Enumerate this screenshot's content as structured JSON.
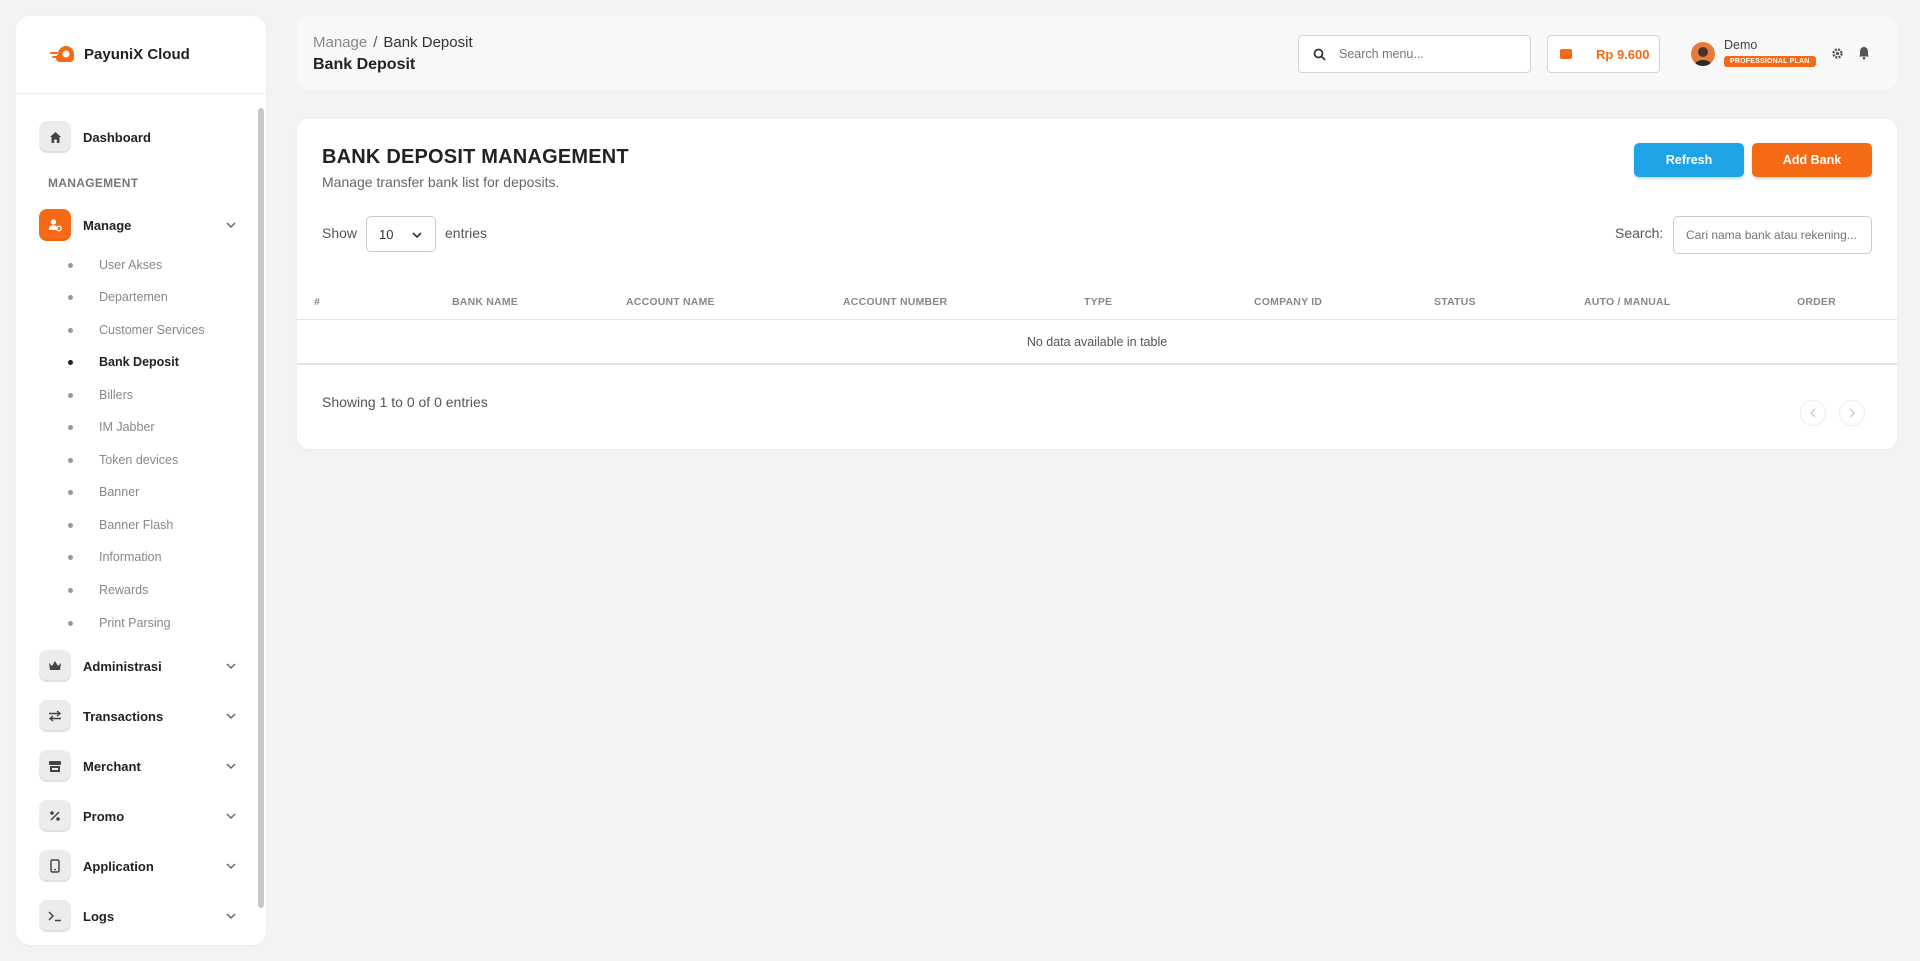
{
  "brand": {
    "name": "PayuniX Cloud"
  },
  "sidebar": {
    "dashboard": "Dashboard",
    "section": "MANAGEMENT",
    "manage": "Manage",
    "sub_items": [
      "User Akses",
      "Departemen",
      "Customer Services",
      "Bank Deposit",
      "Billers",
      "IM Jabber",
      "Token devices",
      "Banner",
      "Banner Flash",
      "Information",
      "Rewards",
      "Print Parsing"
    ],
    "groups": [
      "Administrasi",
      "Transactions",
      "Merchant",
      "Promo",
      "Application",
      "Logs"
    ]
  },
  "header": {
    "crumb_parent": "Manage",
    "crumb_sep": "/",
    "crumb_current": "Bank Deposit",
    "title": "Bank Deposit",
    "search_placeholder": "Search menu...",
    "balance": "Rp 9.600",
    "user_name": "Demo",
    "plan": "PROFESSIONAL PLAN"
  },
  "card": {
    "title": "BANK DEPOSIT MANAGEMENT",
    "subtitle": "Manage transfer bank list for deposits.",
    "refresh_label": "Refresh",
    "add_label": "Add Bank",
    "show_label": "Show",
    "page_length": "10",
    "entries_label": "entries",
    "search_label": "Search:",
    "search_placeholder": "Cari nama bank atau rekening...",
    "columns": [
      "#",
      "BANK NAME",
      "ACCOUNT NAME",
      "ACCOUNT NUMBER",
      "TYPE",
      "COMPANY ID",
      "STATUS",
      "AUTO / MANUAL",
      "ORDER"
    ],
    "empty_text": "No data available in table",
    "info": "Showing 1 to 0 of 0 entries"
  },
  "colors": {
    "accent": "#f56a14",
    "info": "#1ea4e6"
  }
}
